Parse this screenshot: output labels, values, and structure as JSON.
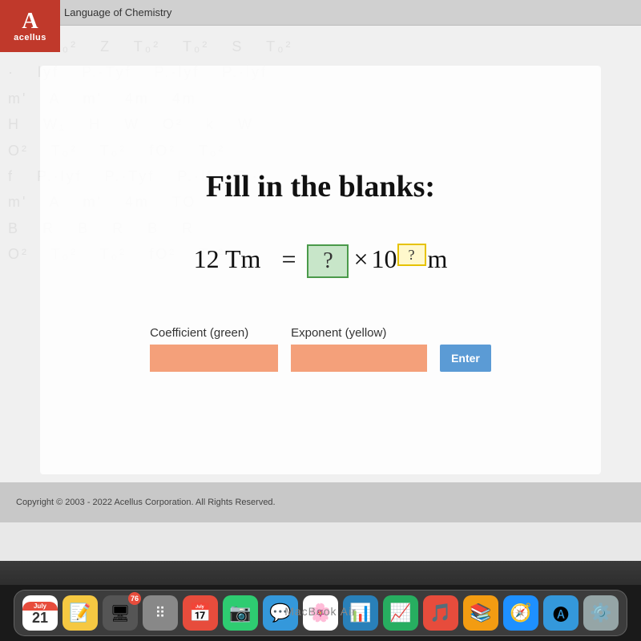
{
  "titlebar": {
    "course_title": "Language of Chemistry"
  },
  "acellus": {
    "logo_letter": "A",
    "logo_name": "acellus"
  },
  "main": {
    "heading": "Fill in the blanks:",
    "equation": {
      "left_side": "12 Tm",
      "equals": "=",
      "coefficient_placeholder": "?",
      "times_symbol": "×",
      "base": "10",
      "exponent_placeholder": "?",
      "unit": "m"
    },
    "inputs": {
      "coefficient_label": "Coefficient (green)",
      "exponent_label": "Exponent (yellow)",
      "enter_button_label": "Enter"
    }
  },
  "footer": {
    "copyright": "Copyright © 2003 - 2022 Acellus Corporation. All Rights Reserved."
  },
  "dock": {
    "label": "MacBook Air",
    "items": [
      {
        "name": "calendar",
        "type": "calendar",
        "month": "July",
        "day": "21"
      },
      {
        "name": "notes",
        "color": "#f5c842",
        "icon": "📝"
      },
      {
        "name": "badges-76",
        "badge": "76"
      },
      {
        "name": "launchpad",
        "color": "#888",
        "icon": "⠿"
      },
      {
        "name": "calendar2",
        "color": "#e74c3c",
        "icon": "📅"
      },
      {
        "name": "facetime",
        "color": "#2ecc71",
        "icon": "📷"
      },
      {
        "name": "messages",
        "color": "#3498db",
        "icon": "💬"
      },
      {
        "name": "photos",
        "color": "multicolor",
        "icon": "🌸"
      },
      {
        "name": "keynote",
        "icon": "📊"
      },
      {
        "name": "numbers",
        "icon": "📈"
      },
      {
        "name": "itunes",
        "icon": "🎵"
      },
      {
        "name": "books",
        "icon": "📚"
      },
      {
        "name": "safari",
        "icon": "🧭"
      },
      {
        "name": "appstore",
        "icon": "🅐"
      },
      {
        "name": "systemprefs",
        "icon": "⚙️"
      }
    ]
  }
}
